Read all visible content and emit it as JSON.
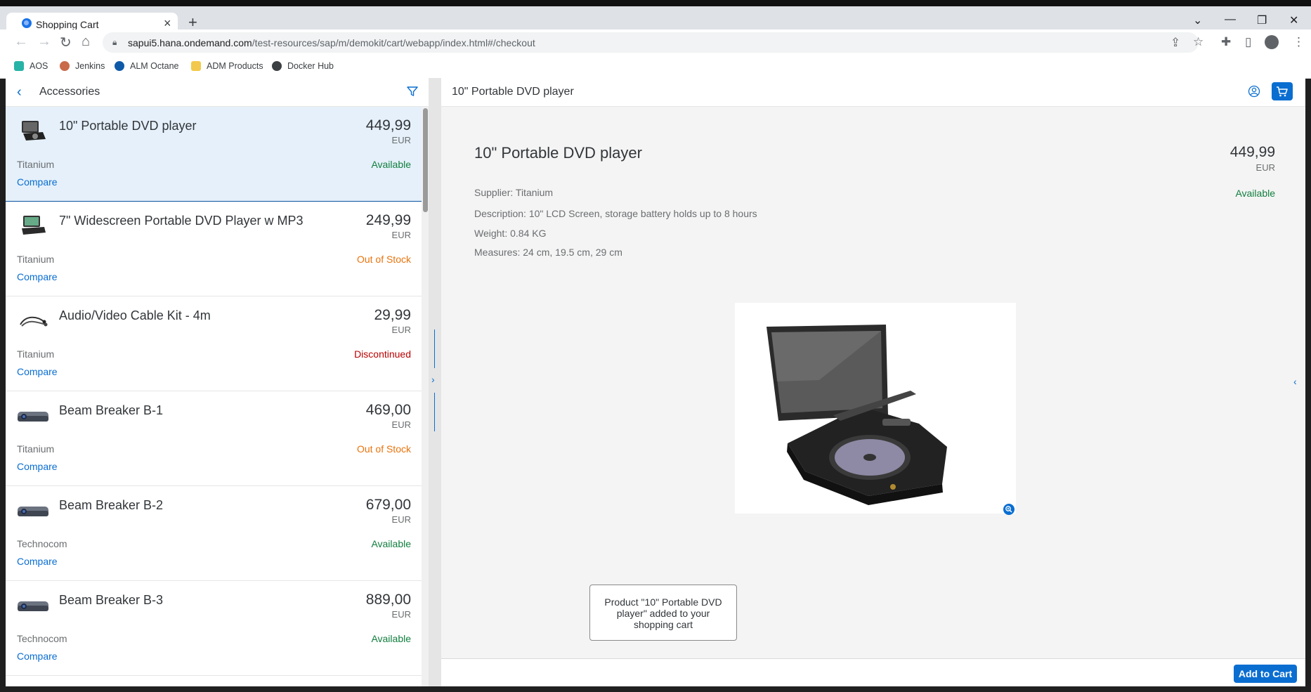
{
  "browser": {
    "tab_title": "Shopping Cart",
    "url_host": "sapui5.hana.ondemand.com",
    "url_path": "/test-resources/sap/m/demokit/cart/webapp/index.html#/checkout",
    "bookmarks": [
      {
        "label": "AOS",
        "icon": "aos-icon"
      },
      {
        "label": "Jenkins",
        "icon": "jenkins-icon"
      },
      {
        "label": "ALM Octane",
        "icon": "octane-icon"
      },
      {
        "label": "ADM Products",
        "icon": "folder-icon"
      },
      {
        "label": "Docker Hub",
        "icon": "docker-icon"
      }
    ]
  },
  "master": {
    "title": "Accessories",
    "items": [
      {
        "name": "10\" Portable DVD player",
        "price": "449,99",
        "currency": "EUR",
        "supplier": "Titanium",
        "status": "Available",
        "status_color": "#107e3e",
        "compare": "Compare"
      },
      {
        "name": "7\" Widescreen Portable DVD Player w MP3",
        "price": "249,99",
        "currency": "EUR",
        "supplier": "Titanium",
        "status": "Out of Stock",
        "status_color": "#e9730c",
        "compare": "Compare"
      },
      {
        "name": "Audio/Video Cable Kit - 4m",
        "price": "29,99",
        "currency": "EUR",
        "supplier": "Titanium",
        "status": "Discontinued",
        "status_color": "#bb0000",
        "compare": "Compare"
      },
      {
        "name": "Beam Breaker B-1",
        "price": "469,00",
        "currency": "EUR",
        "supplier": "Titanium",
        "status": "Out of Stock",
        "status_color": "#e9730c",
        "compare": "Compare"
      },
      {
        "name": "Beam Breaker B-2",
        "price": "679,00",
        "currency": "EUR",
        "supplier": "Technocom",
        "status": "Available",
        "status_color": "#107e3e",
        "compare": "Compare"
      },
      {
        "name": "Beam Breaker B-3",
        "price": "889,00",
        "currency": "EUR",
        "supplier": "Technocom",
        "status": "Available",
        "status_color": "#107e3e",
        "compare": "Compare"
      }
    ]
  },
  "detail": {
    "header_title": "10\" Portable DVD player",
    "title": "10\" Portable DVD player",
    "price": "449,99",
    "currency": "EUR",
    "status": "Available",
    "supplier_label": "Supplier:",
    "supplier": "Titanium",
    "description_label": "Description:",
    "description": "10\" LCD Screen, storage battery holds up to 8 hours",
    "weight_label": "Weight:",
    "weight": "0.84 KG",
    "measures_label": "Measures:",
    "measures": "24 cm, 19.5 cm, 29 cm",
    "toast": "Product \"10\" Portable DVD player\" added to your shopping cart",
    "add_to_cart": "Add to Cart"
  },
  "colors": {
    "accent": "#0a6ed1",
    "selected_row": "#e5f0fa",
    "available": "#107e3e",
    "out_of_stock": "#e9730c",
    "discontinued": "#bb0000"
  }
}
